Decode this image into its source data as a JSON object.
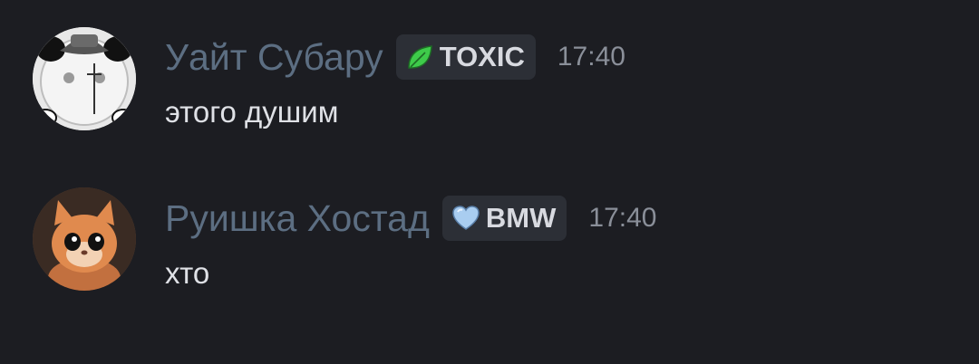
{
  "messages": [
    {
      "author": "Уайт Субару",
      "badge": {
        "label": "TOXIC",
        "icon": "leaf-icon",
        "color": "#3ecb4a"
      },
      "timestamp": "17:40",
      "text": "этого душим",
      "avatar": "avatar-cat-with-hat"
    },
    {
      "author": "Руишка Хостад",
      "badge": {
        "label": "BMW",
        "icon": "heart-icon",
        "color": "#a9cdf0"
      },
      "timestamp": "17:40",
      "text": "хто",
      "avatar": "avatar-kitten"
    }
  ],
  "colors": {
    "background": "#1c1d22",
    "username": "#5c6e82",
    "message_text": "#dfe1e6",
    "timestamp": "#8a8f99",
    "badge_bg": "#2c2f36"
  }
}
